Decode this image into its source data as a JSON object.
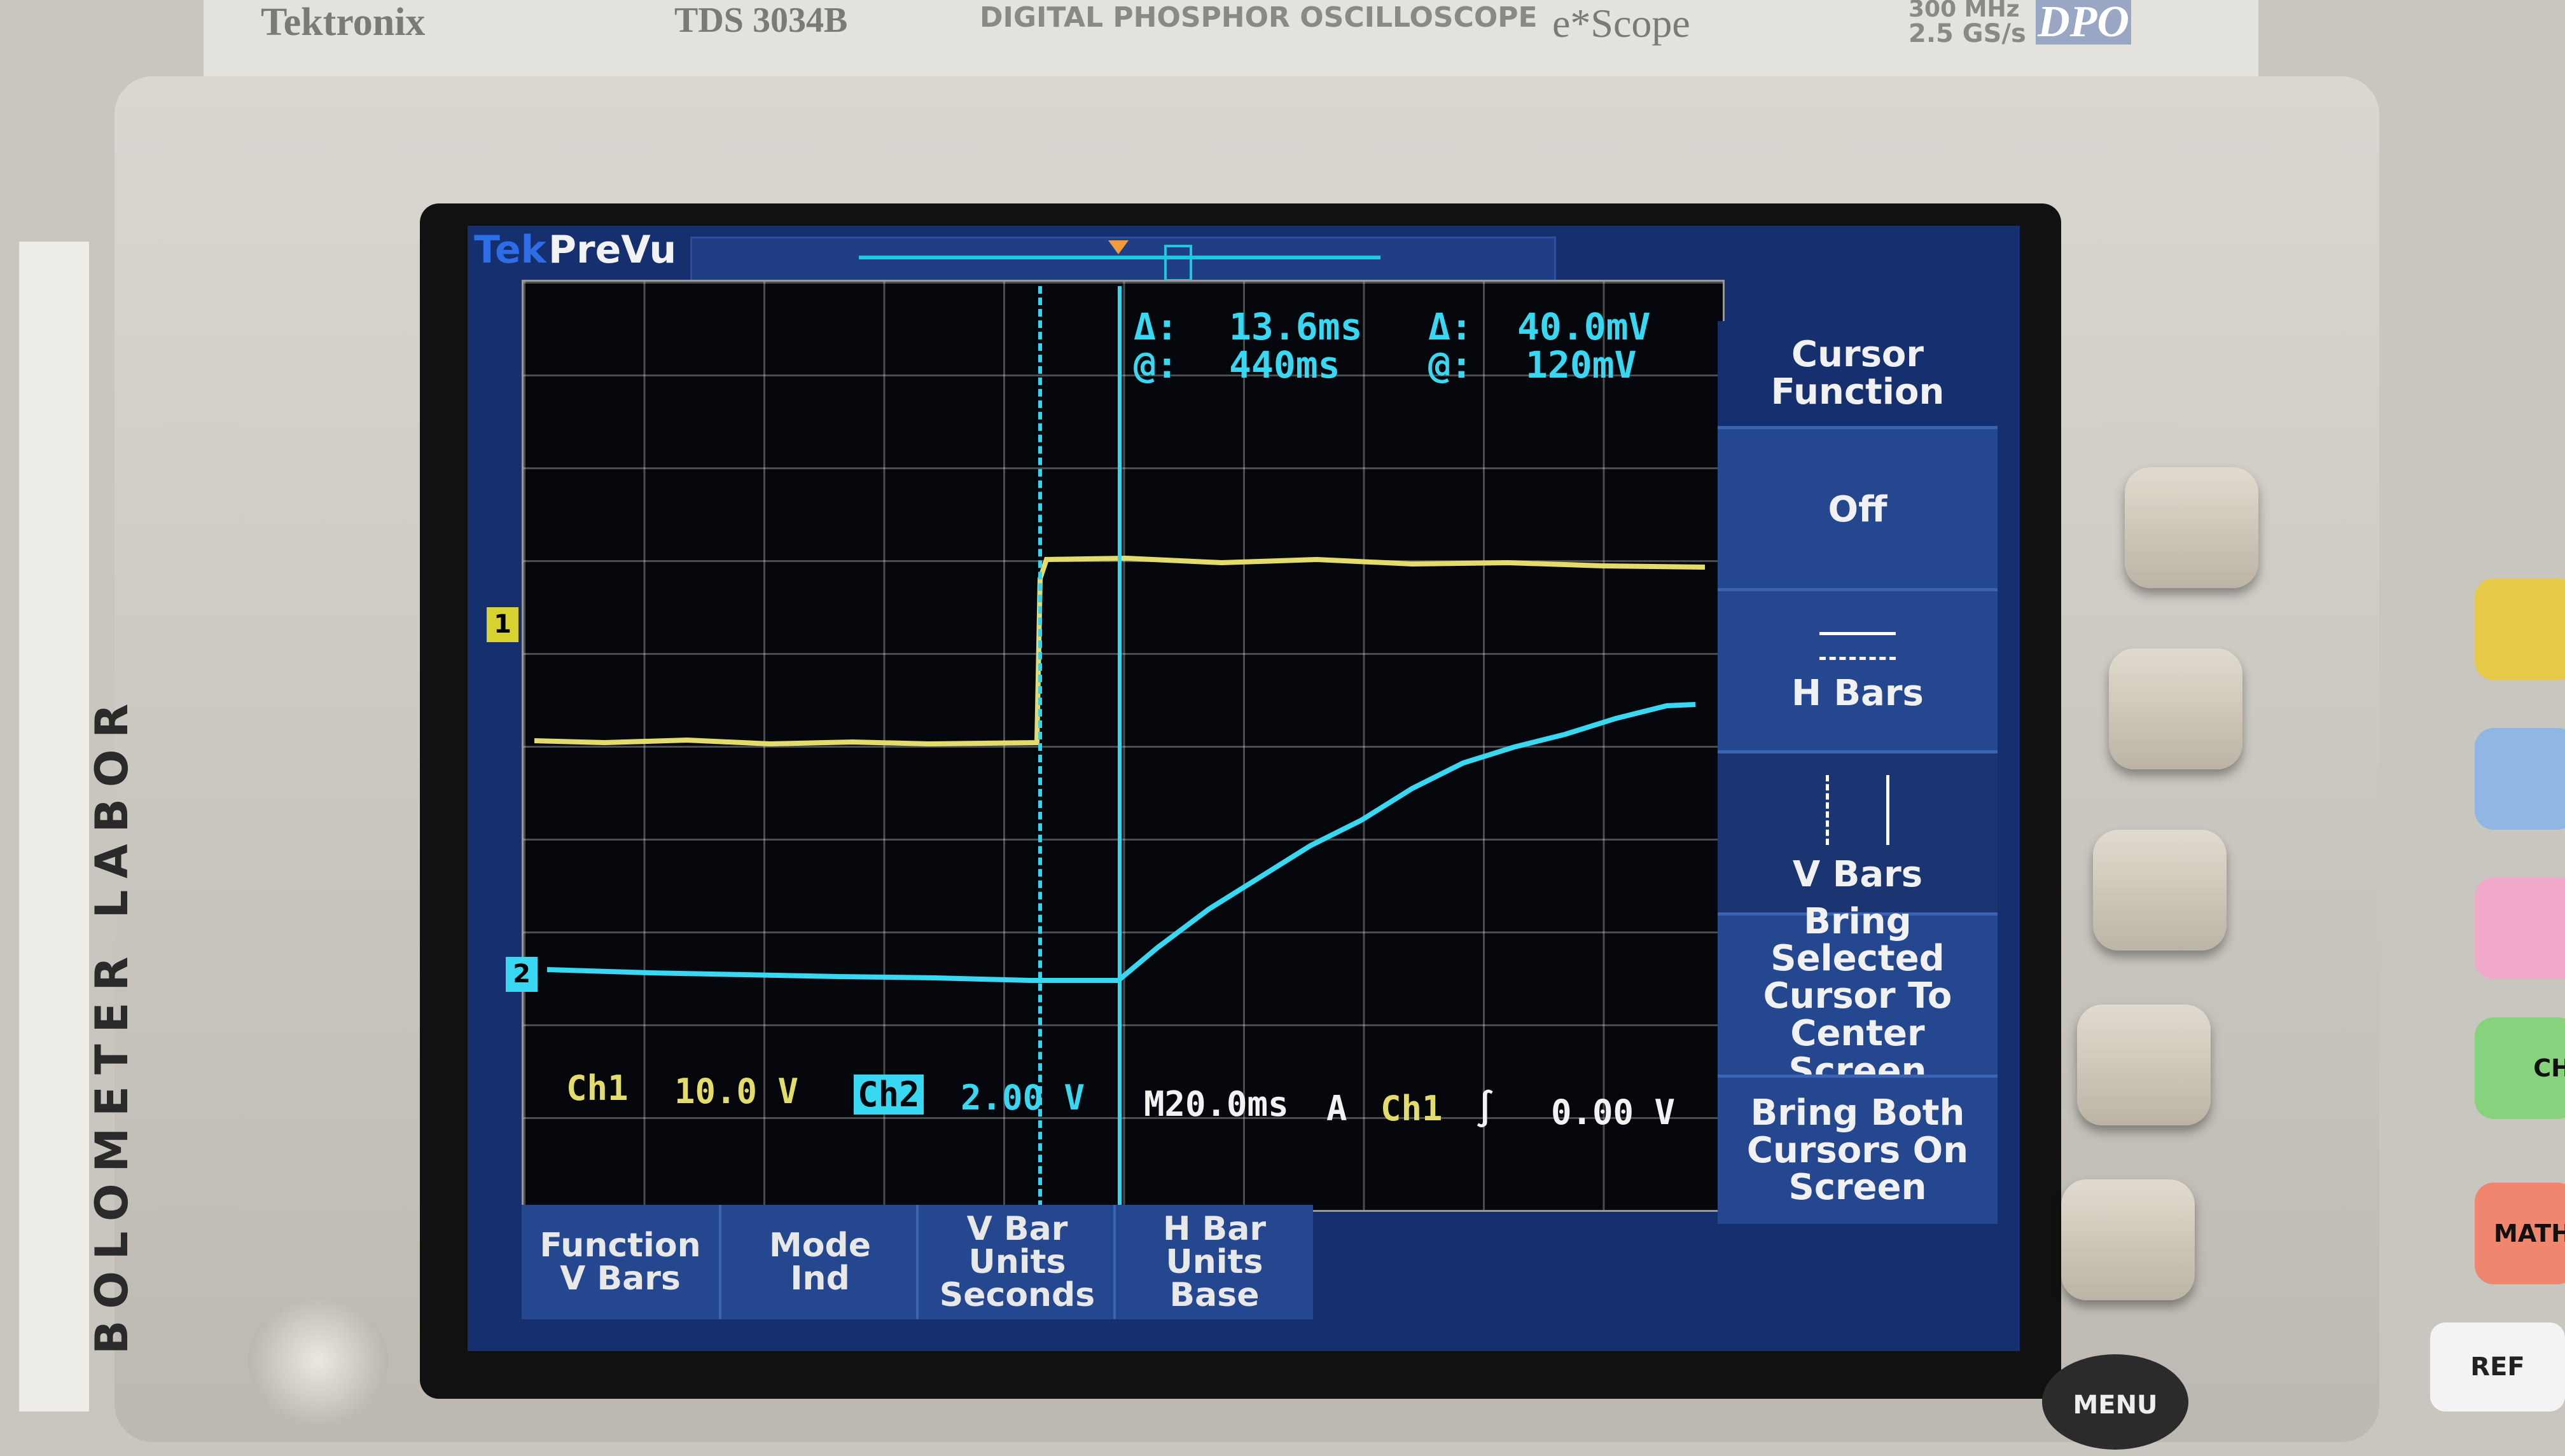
{
  "header": {
    "brand": "Tektronix",
    "model": "TDS 3034B",
    "description": "DIGITAL PHOSPHOR OSCILLOSCOPE",
    "escope": "e*Scope",
    "bandwidth": "300 MHz",
    "sample_rate": "2.5 GS/s",
    "dpo_badge": "DPO"
  },
  "label_strip": "BOLOMETER LABOR",
  "screen": {
    "tek": "Tek",
    "mode": "PreVu",
    "cursor_readout": {
      "time_delta_symbol": "Δ:",
      "time_delta": "13.6ms",
      "time_at_symbol": "@:",
      "time_at": "440ms",
      "volt_delta_symbol": "Δ:",
      "volt_delta": "40.0mV",
      "volt_at_symbol": "@:",
      "volt_at": "120mV"
    },
    "ch1_marker": "1",
    "ch2_marker": "2",
    "status": {
      "ch1_label": "Ch1",
      "ch1_scale": "10.0 V",
      "ch2_label": "Ch2",
      "ch2_scale": "2.00 V",
      "timebase": "M20.0ms",
      "trigger_mode": "A",
      "trigger_source": "Ch1",
      "trigger_slope": "∫",
      "trigger_level": "0.00 V"
    },
    "colors": {
      "ch1": "#e3dc6a",
      "ch2": "#38d8f2",
      "background": "#16306f"
    }
  },
  "side_menu": {
    "title": "Cursor Function",
    "items": [
      "Off",
      "H Bars",
      "V Bars",
      "Bring Selected Cursor To Center Screen",
      "Bring Both Cursors On Screen"
    ],
    "selected": "V Bars"
  },
  "bottom_menu": [
    {
      "top": "Function",
      "bottom": "V Bars"
    },
    {
      "top": "Mode",
      "bottom": "Ind"
    },
    {
      "top": "V Bar Units",
      "bottom": "Seconds"
    },
    {
      "top": "H Bar Units",
      "bottom": "Base"
    }
  ],
  "front_panel": {
    "menu_button": "MENU",
    "ref_button": "REF",
    "math_button": "MATH",
    "ch_button": "CH"
  }
}
